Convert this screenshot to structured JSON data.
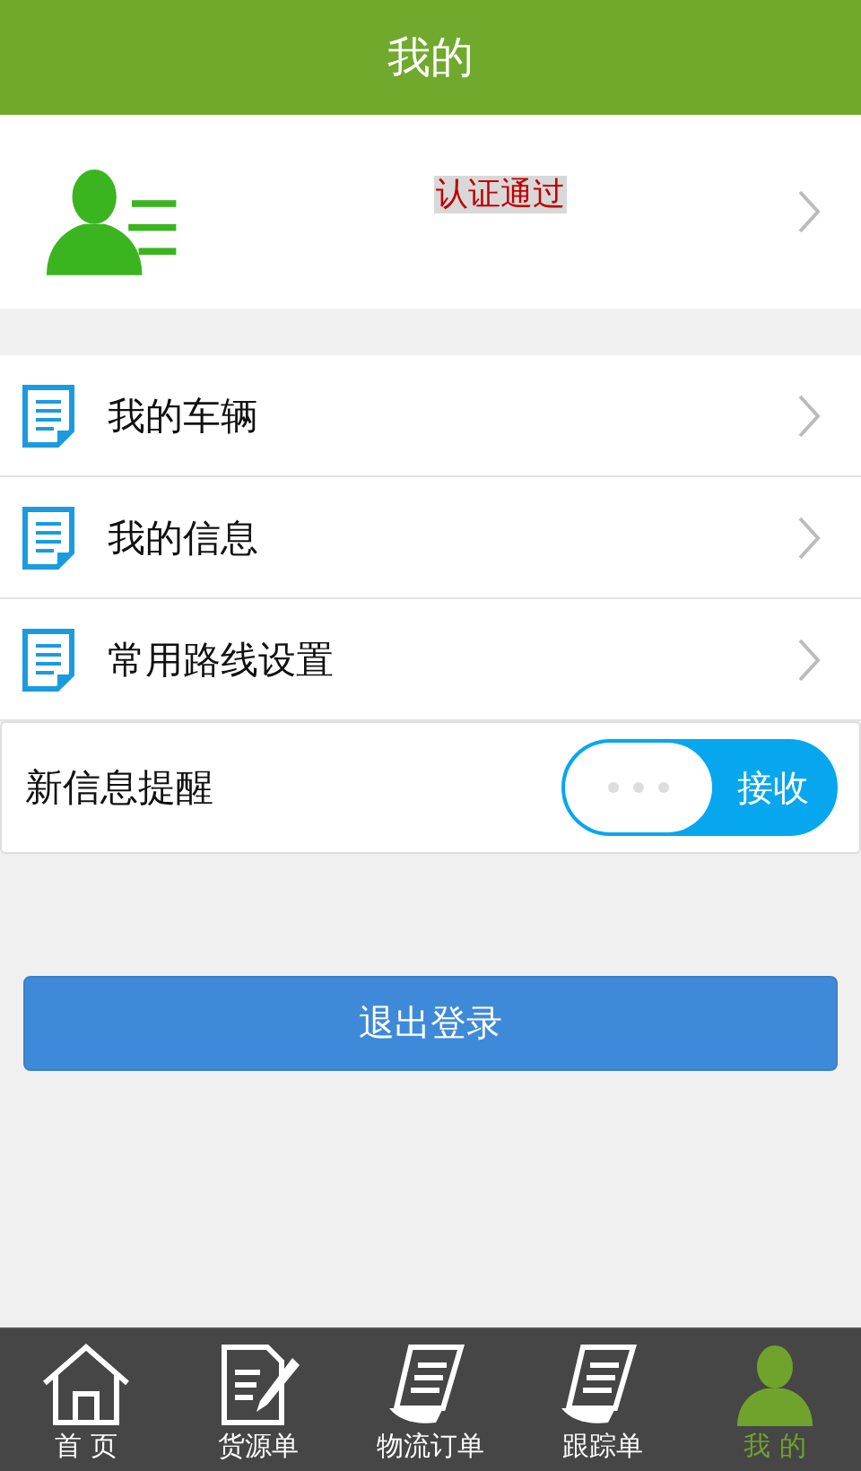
{
  "header": {
    "title": "我的"
  },
  "profile": {
    "badge": "认证通过"
  },
  "menu": [
    {
      "label": "我的车辆"
    },
    {
      "label": "我的信息"
    },
    {
      "label": "常用路线设置"
    }
  ],
  "notification": {
    "label": "新信息提醒",
    "toggle": {
      "on": true,
      "label": "接收"
    }
  },
  "logout_button": "退出登录",
  "tab_bar": [
    {
      "kind": "home",
      "label": "首 页",
      "selected": false
    },
    {
      "kind": "edit",
      "label": "货源单",
      "selected": false
    },
    {
      "kind": "list",
      "label": "物流订单",
      "selected": false
    },
    {
      "kind": "list",
      "label": "跟踪单",
      "selected": false
    },
    {
      "kind": "person",
      "label": "我 的",
      "selected": true
    }
  ]
}
